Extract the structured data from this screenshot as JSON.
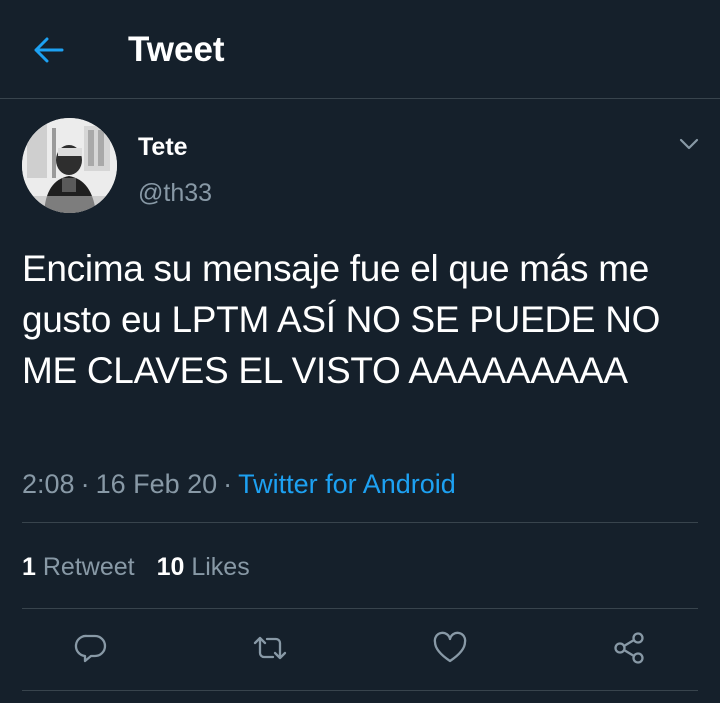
{
  "header": {
    "title": "Tweet",
    "back_icon": "arrow-left-icon",
    "accent_color": "#1da1f2"
  },
  "author": {
    "name": "Tete",
    "handle": "@th33",
    "menu_icon": "chevron-down-icon"
  },
  "tweet": {
    "text": "Encima su mensaje fue el que más me gusto eu LPTM ASÍ NO SE PUEDE NO ME CLAVES EL VISTO AAAAAAAAA",
    "time": "2:08",
    "date": "16 Feb 20",
    "separator": "·",
    "source": "Twitter for Android"
  },
  "stats": {
    "retweets_count": "1",
    "retweets_label": "Retweet",
    "likes_count": "10",
    "likes_label": "Likes"
  },
  "actions": {
    "reply_icon": "reply-icon",
    "retweet_icon": "retweet-icon",
    "like_icon": "heart-icon",
    "share_icon": "share-icon"
  },
  "colors": {
    "background": "#15202b",
    "secondary_text": "#8899a6",
    "divider": "#38444d"
  }
}
